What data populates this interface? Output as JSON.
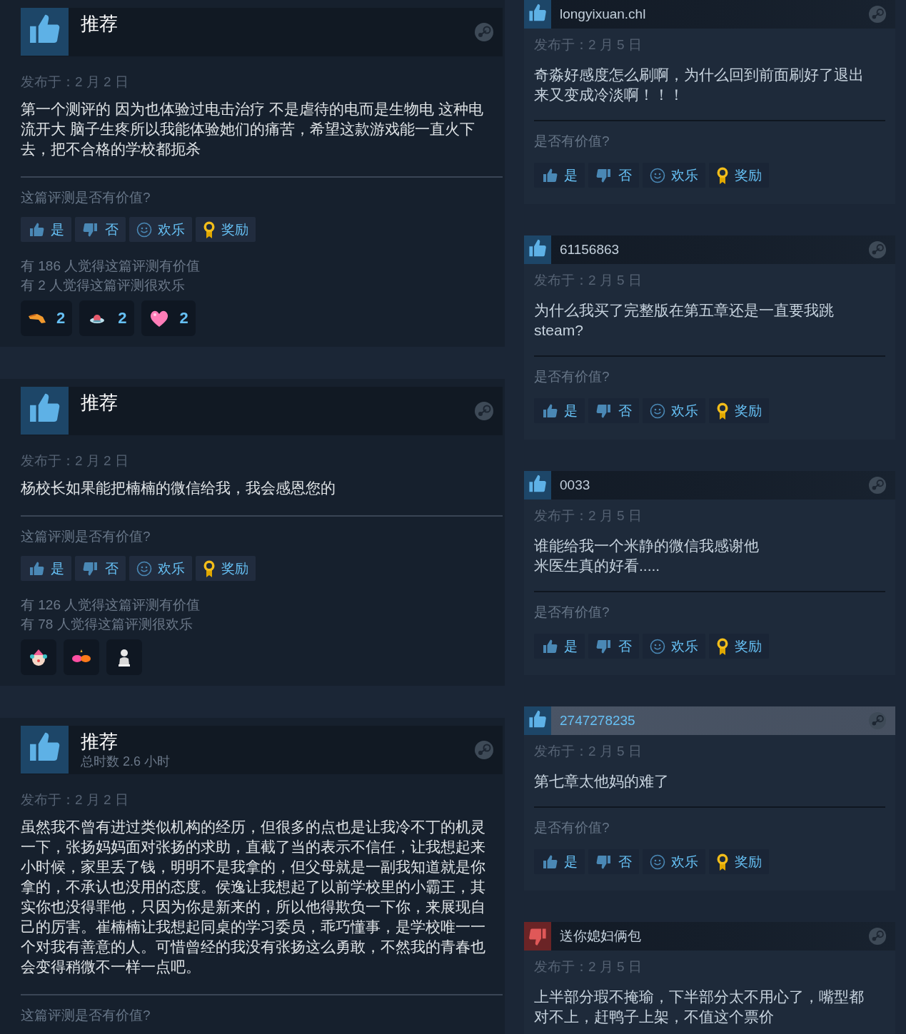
{
  "left_reviews": [
    {
      "recommended": true,
      "title": "推荐",
      "date": "发布于：2 月 2 日",
      "text": "第一个测评的 因为也体验过电击治疗 不是虐待的电而是生物电 这种电流开大 脑子生疼所以我能体验她们的痛苦，希望这款游戏能一直火下去，把不合格的学校都扼杀",
      "question": "这篇评测是否有价值?",
      "buttons": [
        {
          "kind": "yes",
          "label": "是"
        },
        {
          "kind": "no",
          "label": "否"
        },
        {
          "kind": "funny",
          "label": "欢乐"
        },
        {
          "kind": "award",
          "label": "奖励"
        }
      ],
      "helpful": "有 186 人觉得这篇评测有价值",
      "funny": "有 2 人觉得这篇评测很欢乐",
      "awards": [
        {
          "kind": "hand",
          "count": "2"
        },
        {
          "kind": "ufo",
          "count": "2"
        },
        {
          "kind": "heart",
          "count": "2"
        }
      ]
    },
    {
      "recommended": true,
      "title": "推荐",
      "date": "发布于：2 月 2 日",
      "text": "杨校长如果能把楠楠的微信给我，我会感恩您的",
      "question": "这篇评测是否有价值?",
      "buttons": [
        {
          "kind": "yes",
          "label": "是"
        },
        {
          "kind": "no",
          "label": "否"
        },
        {
          "kind": "funny",
          "label": "欢乐"
        },
        {
          "kind": "award",
          "label": "奖励"
        }
      ],
      "helpful": "有 126 人觉得这篇评测有价值",
      "funny": "有 78 人觉得这篇评测很欢乐",
      "awards": [
        {
          "kind": "clown"
        },
        {
          "kind": "gloves"
        },
        {
          "kind": "bust"
        }
      ]
    },
    {
      "recommended": true,
      "title": "推荐",
      "playtime": "总时数 2.6 小时",
      "date": "发布于：2 月 2 日",
      "text": "虽然我不曾有进过类似机构的经历，但很多的点也是让我冷不丁的机灵一下，张扬妈妈面对张扬的求助，直截了当的表示不信任，让我想起来小时候，家里丢了钱，明明不是我拿的，但父母就是一副我知道就是你拿的，不承认也没用的态度。侯逸让我想起了以前学校里的小霸王，其实你也没得罪他，只因为你是新来的，所以他得欺负一下你，来展现自己的厉害。崔楠楠让我想起同桌的学习委员，乖巧懂事，是学校唯一一个对我有善意的人。可惜曾经的我没有张扬这么勇敢，不然我的青春也会变得稍微不一样一点吧。",
      "question": "这篇评测是否有价值?"
    }
  ],
  "right_reviews": [
    {
      "recommended": true,
      "username": "longyixuan.chl",
      "highlighted": false,
      "date": "发布于：2 月 5 日",
      "text": "奇淼好感度怎么刷啊，为什么回到前面刷好了退出来又变成冷淡啊！！！",
      "question": "是否有价值?",
      "buttons": [
        {
          "kind": "yes",
          "label": "是"
        },
        {
          "kind": "no",
          "label": "否"
        },
        {
          "kind": "funny",
          "label": "欢乐"
        },
        {
          "kind": "award",
          "label": "奖励"
        }
      ]
    },
    {
      "recommended": true,
      "username": "61156863",
      "highlighted": false,
      "date": "发布于：2 月 5 日",
      "text": "为什么我买了完整版在第五章还是一直要我跳steam?",
      "question": "是否有价值?",
      "buttons": [
        {
          "kind": "yes",
          "label": "是"
        },
        {
          "kind": "no",
          "label": "否"
        },
        {
          "kind": "funny",
          "label": "欢乐"
        },
        {
          "kind": "award",
          "label": "奖励"
        }
      ]
    },
    {
      "recommended": true,
      "username": "0033",
      "highlighted": false,
      "date": "发布于：2 月 5 日",
      "text_lines": [
        "谁能给我一个米静的微信我感谢他",
        "米医生真的好看....."
      ],
      "question": "是否有价值?",
      "buttons": [
        {
          "kind": "yes",
          "label": "是"
        },
        {
          "kind": "no",
          "label": "否"
        },
        {
          "kind": "funny",
          "label": "欢乐"
        },
        {
          "kind": "award",
          "label": "奖励"
        }
      ]
    },
    {
      "recommended": true,
      "username": "2747278235",
      "highlighted": true,
      "date": "发布于：2 月 5 日",
      "text": "第七章太他妈的难了",
      "question": "是否有价值?",
      "buttons": [
        {
          "kind": "yes",
          "label": "是"
        },
        {
          "kind": "no",
          "label": "否"
        },
        {
          "kind": "funny",
          "label": "欢乐"
        },
        {
          "kind": "award",
          "label": "奖励"
        }
      ]
    },
    {
      "recommended": false,
      "username": "送你媳妇俩包",
      "highlighted": false,
      "date": "发布于：2 月 5 日",
      "text": "上半部分瑕不掩瑜，下半部分太不用心了，嘴型都对不上，赶鸭子上架，不值这个票价"
    }
  ]
}
